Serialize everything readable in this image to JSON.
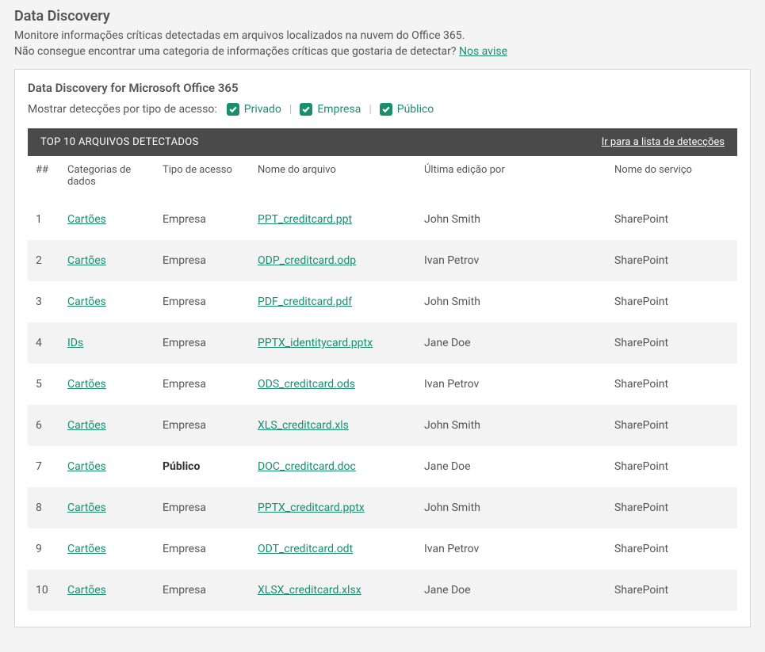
{
  "header": {
    "title": "Data Discovery",
    "subtitle": "Monitore informações críticas detectadas em arquivos localizados na nuvem do Office 365.",
    "feedback_text": "Não consegue encontrar uma categoria de informações críticas que gostaria de detectar? ",
    "feedback_link": "Nos avise"
  },
  "panel": {
    "title": "Data Discovery for Microsoft Office 365",
    "filter_label": "Mostrar detecções por tipo de acesso:",
    "filters": [
      {
        "label": "Privado",
        "checked": true
      },
      {
        "label": "Empresa",
        "checked": true
      },
      {
        "label": "Público",
        "checked": true
      }
    ],
    "divider": "|"
  },
  "table": {
    "bar_title": "TOP 10 ARQUIVOS DETECTADOS",
    "bar_link": "Ir para a lista de detecções",
    "columns": {
      "num": "##",
      "category": "Categorias de dados",
      "access": "Tipo de acesso",
      "filename": "Nome do arquivo",
      "editor": "Última edição por",
      "service": "Nome do serviço"
    },
    "rows": [
      {
        "num": "1",
        "category": "Cartões",
        "access": "Empresa",
        "access_bold": false,
        "filename": "PPT_creditcard.ppt",
        "editor": "John Smith",
        "service": "SharePoint"
      },
      {
        "num": "2",
        "category": "Cartões",
        "access": "Empresa",
        "access_bold": false,
        "filename": "ODP_creditcard.odp",
        "editor": "Ivan Petrov",
        "service": "SharePoint"
      },
      {
        "num": "3",
        "category": "Cartões",
        "access": "Empresa",
        "access_bold": false,
        "filename": "PDF_creditcard.pdf",
        "editor": "John Smith",
        "service": "SharePoint"
      },
      {
        "num": "4",
        "category": "IDs",
        "access": "Empresa",
        "access_bold": false,
        "filename": "PPTX_identitycard.pptx",
        "editor": "Jane Doe",
        "service": "SharePoint"
      },
      {
        "num": "5",
        "category": "Cartões",
        "access": "Empresa",
        "access_bold": false,
        "filename": "ODS_creditcard.ods",
        "editor": "Ivan Petrov",
        "service": "SharePoint"
      },
      {
        "num": "6",
        "category": "Cartões",
        "access": "Empresa",
        "access_bold": false,
        "filename": "XLS_creditcard.xls",
        "editor": "John Smith",
        "service": "SharePoint"
      },
      {
        "num": "7",
        "category": "Cartões",
        "access": "Público",
        "access_bold": true,
        "filename": "DOC_creditcard.doc",
        "editor": "Jane Doe",
        "service": "SharePoint"
      },
      {
        "num": "8",
        "category": "Cartões",
        "access": "Empresa",
        "access_bold": false,
        "filename": "PPTX_creditcard.pptx",
        "editor": "John Smith",
        "service": "SharePoint"
      },
      {
        "num": "9",
        "category": "Cartões",
        "access": "Empresa",
        "access_bold": false,
        "filename": "ODT_creditcard.odt",
        "editor": "Ivan Petrov",
        "service": "SharePoint"
      },
      {
        "num": "10",
        "category": "Cartões",
        "access": "Empresa",
        "access_bold": false,
        "filename": "XLSX_creditcard.xlsx",
        "editor": "Jane Doe",
        "service": "SharePoint"
      }
    ]
  }
}
